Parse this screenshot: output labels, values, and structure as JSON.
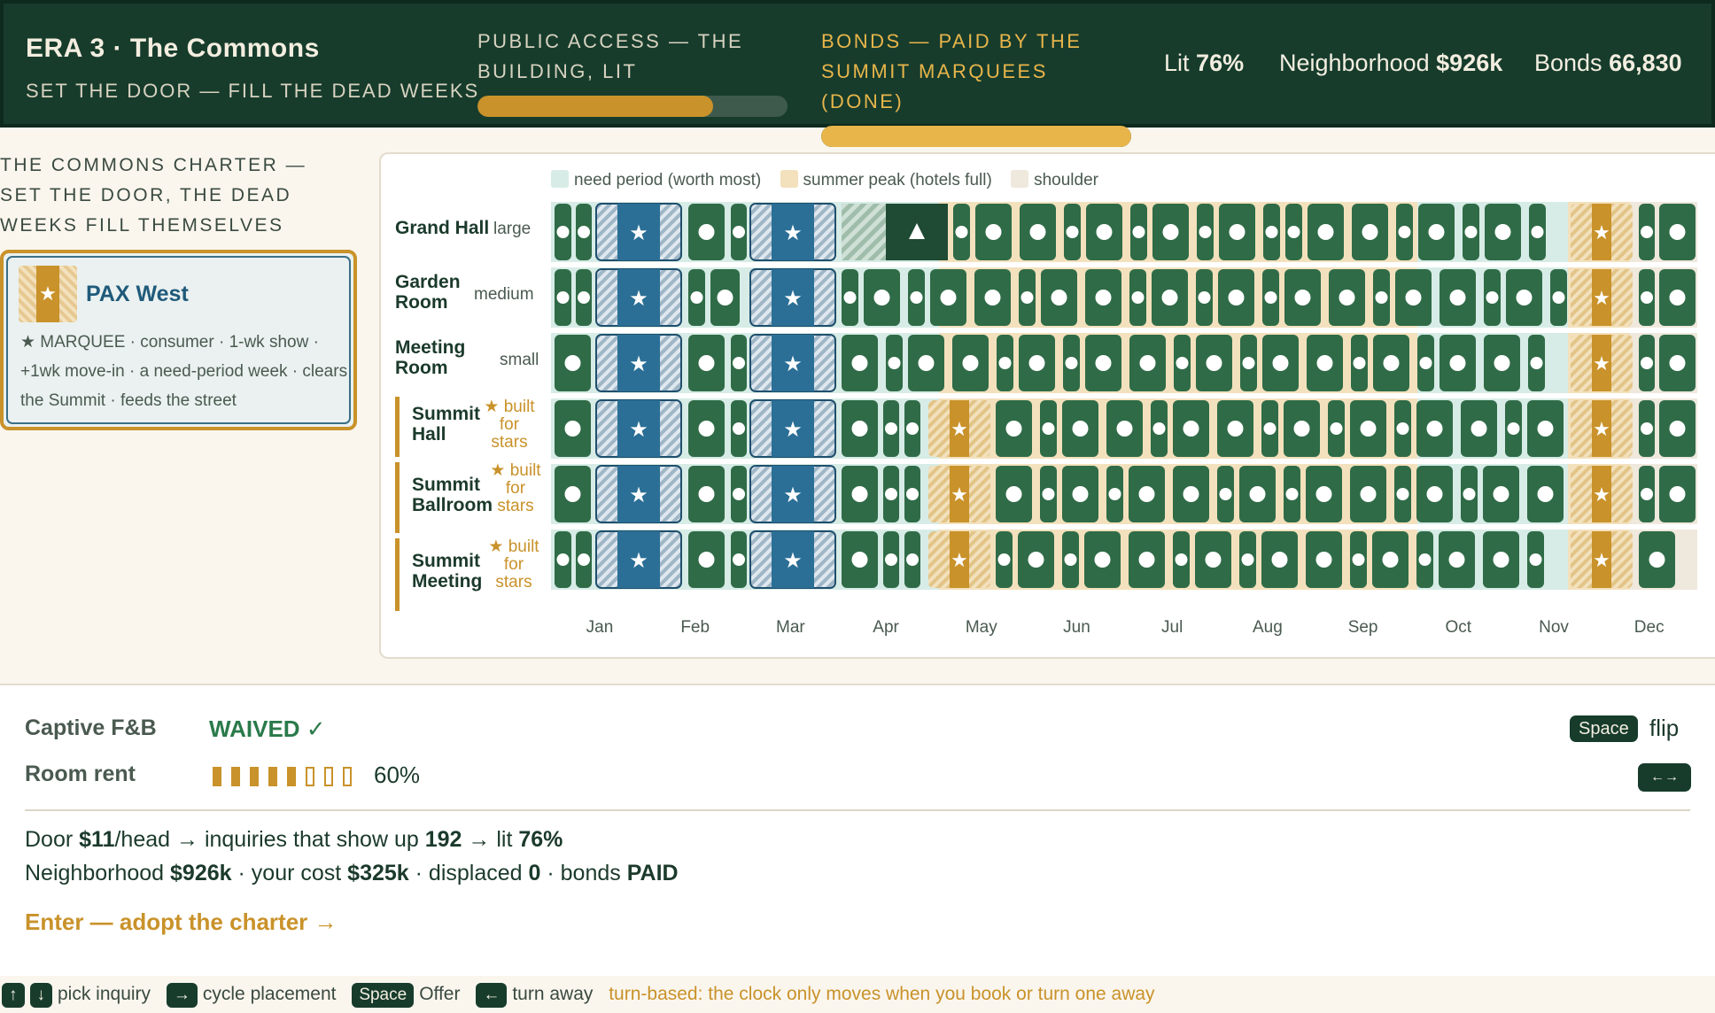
{
  "header": {
    "era_title": "ERA 3 · The Commons",
    "era_subtitle": "SET THE DOOR — FILL THE DEAD WEEKS",
    "progress_public": {
      "label": "PUBLIC ACCESS — THE BUILDING, LIT",
      "fraction": 0.76
    },
    "progress_bonds": {
      "label": "BONDS — PAID BY THE SUMMIT MARQUEES (DONE)",
      "fraction": 1.0
    },
    "stats": {
      "lit_label": "Lit",
      "lit_value": "76%",
      "neighborhood_label": "Neighborhood",
      "neighborhood_value": "$926k",
      "bonds_label": "Bonds",
      "bonds_value": "66,830"
    }
  },
  "charter": {
    "heading": "THE COMMONS CHARTER — SET THE DOOR, THE DEAD WEEKS FILL THEMSELVES",
    "offer": {
      "name": "PAX West",
      "description": "★ MARQUEE · consumer · 1-wk show · +1wk move-in · a need-period week · clears the Summit · feeds the street"
    }
  },
  "calendar": {
    "legend": [
      "need period (worth most)",
      "summer peak (hotels full)",
      "shoulder"
    ],
    "rooms": [
      {
        "name": "Grand Hall",
        "size": "large"
      },
      {
        "name": "Garden Room",
        "size": "medium"
      },
      {
        "name": "Meeting Room",
        "size": "small"
      },
      {
        "name": "Summit Hall",
        "size": "★ built for stars"
      },
      {
        "name": "Summit Ballroom",
        "size": "★ built for stars"
      },
      {
        "name": "Summit Meeting",
        "size": "★ built for stars"
      }
    ],
    "months": [
      "Jan",
      "Feb",
      "Mar",
      "Apr",
      "May",
      "Jun",
      "Jul",
      "Aug",
      "Sep",
      "Oct",
      "Nov",
      "Dec"
    ]
  },
  "controls": {
    "fb_label": "Captive F&B",
    "fb_value": "WAIVED ✓",
    "rent_label": "Room rent",
    "rent_level": 0.6,
    "rent_value": "60%",
    "flip_key": "Space",
    "flip_label": "flip",
    "arrows_key": "←→"
  },
  "summary": {
    "line1": {
      "door_label": "Door",
      "door_value": "$11",
      "door_unit": "/head",
      "inq_label": "→ inquiries that show up",
      "inq_value": "192",
      "lit_label": "→ lit",
      "lit_value": "76%"
    },
    "line2": {
      "nb_label": "Neighborhood",
      "nb_value": "$926k",
      "cost_label": "· your cost",
      "cost_value": "$325k",
      "disp_label": "· displaced",
      "disp_value": "0",
      "bonds_label": "· bonds",
      "bonds_value": "PAID"
    },
    "enter": "Enter — adopt the charter →"
  },
  "footer": {
    "k_up": "↑",
    "k_down": "↓",
    "pick": "pick inquiry",
    "k_right": "→",
    "cycle": "cycle placement",
    "k_space": "Space",
    "offer": "Offer",
    "k_left": "←",
    "turn": "turn away",
    "note": "turn-based: the clock only moves when you book or turn one away"
  },
  "colors": {
    "header_bg": "#173c2c",
    "accent_gold": "#c9922a",
    "bond_gold": "#e8b54a",
    "booked_green": "#2f6b47",
    "marquee_blue": "#2b6f96",
    "need_period": "#d7ece6",
    "summer_peak": "#f3e1bd",
    "shoulder": "#efe8dc"
  },
  "icons": [
    "star-icon",
    "triangle-icon",
    "dot-icon"
  ]
}
